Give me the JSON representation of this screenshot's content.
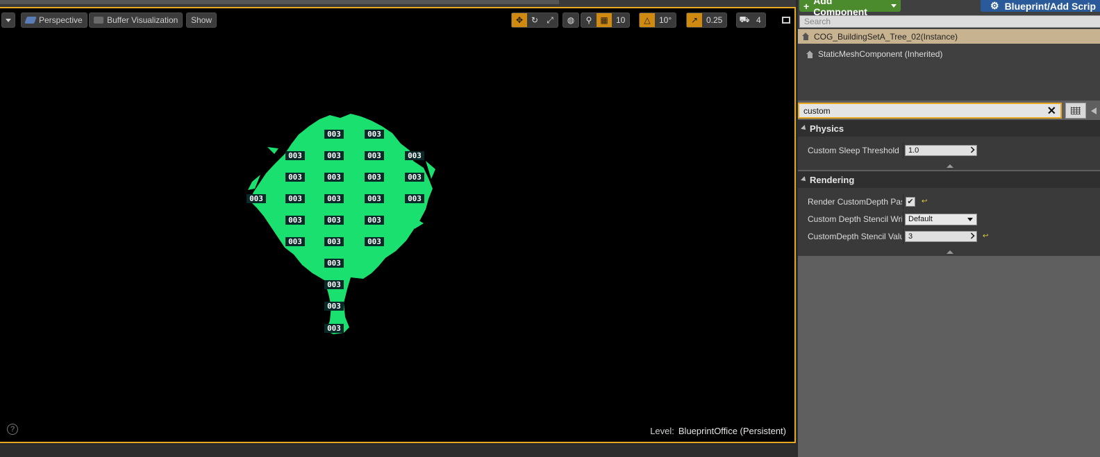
{
  "viewport": {
    "view_mode_label": "Perspective",
    "buffer_label": "Buffer Visualization",
    "show_label": "Show",
    "grid_snap_value": "10",
    "rotation_snap_value": "10°",
    "scale_snap_value": "0.25",
    "camera_speed_value": "4",
    "stencil_text": "003",
    "level_prefix": "Level:",
    "level_value": "BlueprintOffice (Persistent)",
    "help_glyph": "?"
  },
  "components": {
    "add_component_label": "Add Component",
    "blueprint_label": "Blueprint/Add Scrip",
    "search_placeholder": "Search",
    "instance_label": "COG_BuildingSetA_Tree_02(Instance)",
    "inherited_label": "StaticMeshComponent (Inherited)"
  },
  "details": {
    "search_value": "custom",
    "clear_glyph": "✕",
    "physics": {
      "title": "Physics",
      "sleep_threshold_label": "Custom Sleep Threshold M",
      "sleep_threshold_value": "1.0"
    },
    "rendering": {
      "title": "Rendering",
      "render_custom_depth_label": "Render CustomDepth Pass",
      "render_custom_depth_checked": "✔",
      "stencil_write_label": "Custom Depth Stencil Write",
      "stencil_write_value": "Default",
      "stencil_value_label": "CustomDepth Stencil Value",
      "stencil_value": "3"
    },
    "reset_glyph": "↩"
  },
  "colors": {
    "accent": "#e8a820",
    "tree_green": "#1ae070",
    "add_component_green": "#4c8a2e",
    "blueprint_blue": "#2a5a9a",
    "instance_row": "#c8b391"
  }
}
